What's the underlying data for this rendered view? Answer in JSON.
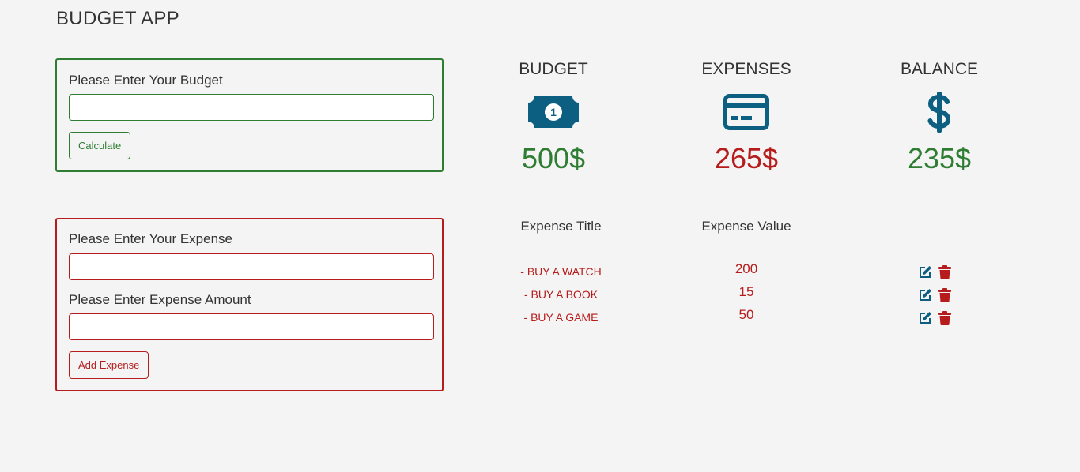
{
  "app": {
    "title": "BUDGET APP"
  },
  "budget_form": {
    "label": "Please Enter Your Budget",
    "input_value": "",
    "input_placeholder": "",
    "button_label": "Calculate"
  },
  "expense_form": {
    "title_label": "Please Enter Your Expense",
    "title_value": "",
    "title_placeholder": "",
    "amount_label": "Please Enter Expense Amount",
    "amount_value": "",
    "amount_placeholder": "",
    "button_label": "Add Expense"
  },
  "summary": {
    "budget": {
      "title": "BUDGET",
      "amount": "500$",
      "icon": "money-bill-icon"
    },
    "expenses": {
      "title": "EXPENSES",
      "amount": "265$",
      "icon": "credit-card-icon"
    },
    "balance": {
      "title": "BALANCE",
      "amount": "235$",
      "icon": "dollar-sign-icon"
    }
  },
  "expense_list": {
    "headers": [
      "Expense Title",
      "Expense Value"
    ],
    "rows": [
      {
        "title": "- BUY A WATCH",
        "value": "200"
      },
      {
        "title": "- BUY A BOOK",
        "value": "15"
      },
      {
        "title": "- BUY A GAME",
        "value": "50"
      }
    ]
  },
  "colors": {
    "background": "#f4f4f4",
    "success_green": "#2e7d32",
    "danger_red": "#b71c1c",
    "icon_blue": "#0d5f82",
    "text_dark": "#333333"
  }
}
